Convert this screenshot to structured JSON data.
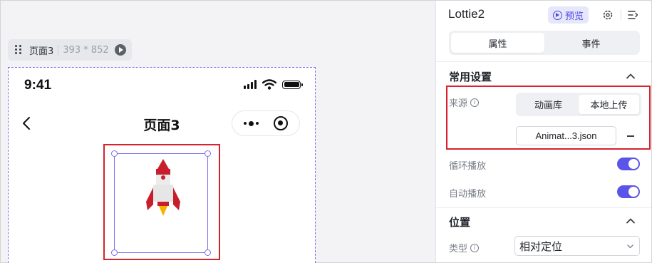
{
  "canvas": {
    "page_tag": {
      "name": "页面3",
      "size": "393 * 852"
    },
    "phone": {
      "status_time": "9:41",
      "nav_title": "页面3"
    }
  },
  "panel": {
    "component_title": "Lottie2",
    "preview_label": "预览",
    "tabs": [
      {
        "label": "属性",
        "active": true
      },
      {
        "label": "事件",
        "active": false
      }
    ],
    "common_section": {
      "title": "常用设置",
      "source": {
        "label": "来源",
        "options": [
          "动画库",
          "本地上传"
        ],
        "selected": "本地上传",
        "file_name": "Animat...3.json"
      },
      "loop": {
        "label": "循环播放",
        "on": true
      },
      "autoplay": {
        "label": "自动播放",
        "on": true
      }
    },
    "position_section": {
      "title": "位置",
      "type": {
        "label": "类型",
        "value": "相对定位"
      }
    }
  },
  "colors": {
    "accent": "#5b54e8",
    "highlight": "#d6232e",
    "selection": "#7a6ff0"
  }
}
